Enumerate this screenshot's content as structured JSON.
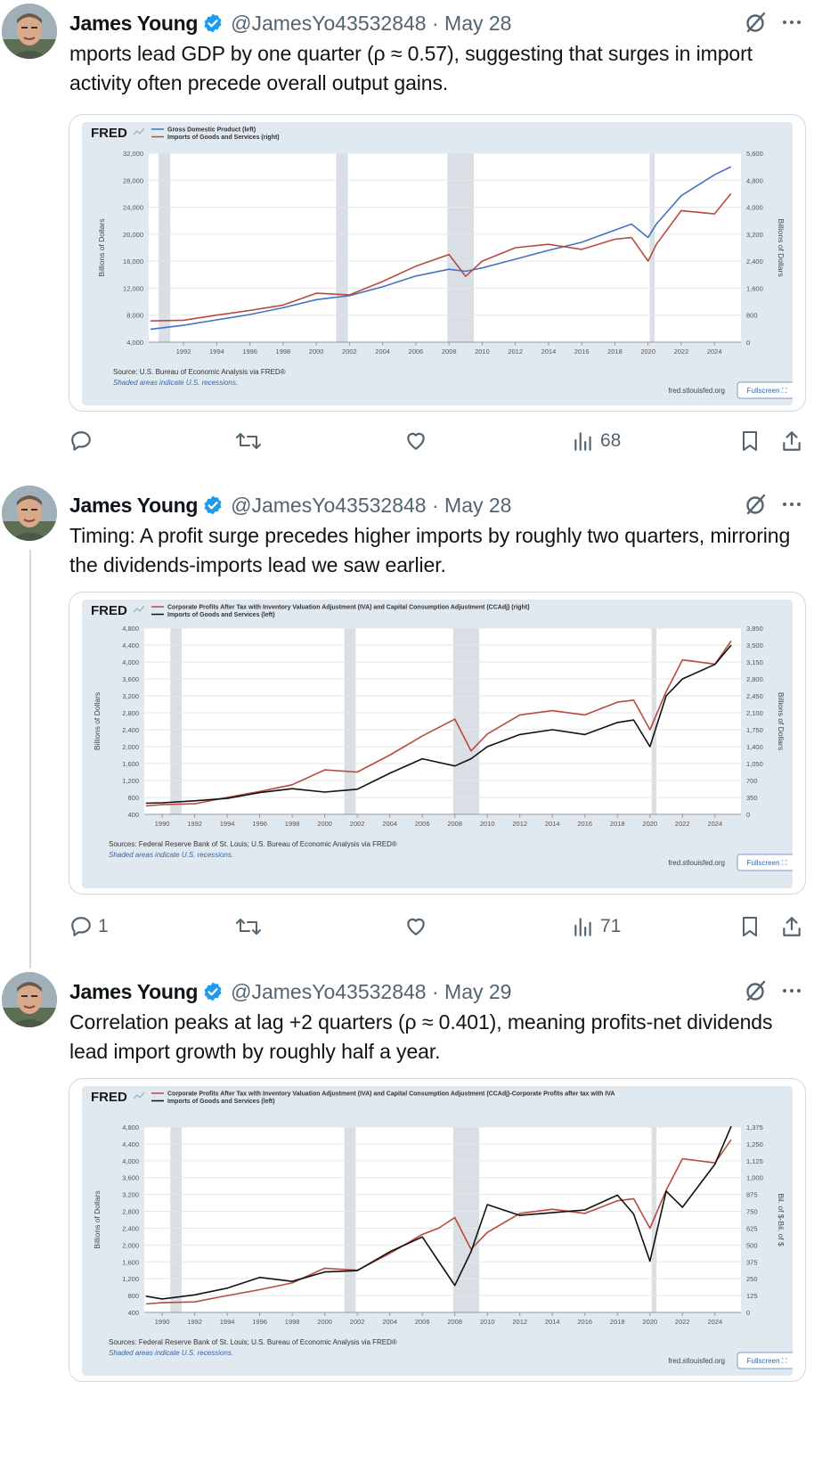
{
  "tweets": [
    {
      "author": {
        "name": "James Young",
        "handle": "@JamesYo43532848"
      },
      "date": "May 28",
      "text": "mports lead GDP by one quarter (ρ ≈ 0.57), suggesting that surges in import activity often precede overall output gains.",
      "chart": {
        "brand": "FRED",
        "legend": [
          "Gross Domestic Product (left)",
          "Imports of Goods and Services (right)"
        ],
        "left_axis_label": "Billions of Dollars",
        "right_axis_label": "Billions of Dollars",
        "left_ticks": [
          "32,000",
          "28,000",
          "24,000",
          "20,000",
          "16,000",
          "12,000",
          "8,000",
          "4,000"
        ],
        "right_ticks": [
          "5,600",
          "4,800",
          "4,000",
          "3,200",
          "2,400",
          "1,600",
          "800",
          "0"
        ],
        "x_ticks": [
          "1992",
          "1994",
          "1996",
          "1998",
          "2000",
          "2002",
          "2004",
          "2006",
          "2008",
          "2010",
          "2012",
          "2014",
          "2016",
          "2018",
          "2020",
          "2022",
          "2024"
        ],
        "source": "Source: U.S. Bureau of Economic Analysis via FRED®",
        "recession_note": "Shaded areas indicate U.S. recessions.",
        "site": "fred.stlouisfed.org",
        "fullscreen": "Fullscreen"
      },
      "stats": {
        "replies": "",
        "reposts": "",
        "likes": "",
        "views": "68"
      }
    },
    {
      "author": {
        "name": "James Young",
        "handle": "@JamesYo43532848"
      },
      "date": "May 28",
      "text": "Timing: A profit surge precedes higher imports by roughly two quarters, mirroring the dividends-imports lead we saw earlier.",
      "chart": {
        "brand": "FRED",
        "legend": [
          "Corporate Profits After Tax with Inventory Valuation Adjustment (IVA) and Capital Consumption Adjustment (CCAdj) (right)",
          "Imports of Goods and Services (left)"
        ],
        "left_axis_label": "Billions of Dollars",
        "right_axis_label": "Billions of Dollars",
        "left_ticks": [
          "4,800",
          "4,400",
          "4,000",
          "3,600",
          "3,200",
          "2,800",
          "2,400",
          "2,000",
          "1,600",
          "1,200",
          "800",
          "400"
        ],
        "right_ticks": [
          "3,850",
          "3,500",
          "3,150",
          "2,800",
          "2,450",
          "2,100",
          "1,750",
          "1,400",
          "1,050",
          "700",
          "350",
          "0"
        ],
        "x_ticks": [
          "1990",
          "1992",
          "1994",
          "1996",
          "1998",
          "2000",
          "2002",
          "2004",
          "2006",
          "2008",
          "2010",
          "2012",
          "2014",
          "2016",
          "2018",
          "2020",
          "2022",
          "2024"
        ],
        "source": "Sources: Federal Reserve Bank of St. Louis; U.S. Bureau of Economic Analysis via FRED®",
        "recession_note": "Shaded areas indicate U.S. recessions.",
        "site": "fred.stlouisfed.org",
        "fullscreen": "Fullscreen"
      },
      "stats": {
        "replies": "1",
        "reposts": "",
        "likes": "",
        "views": "71"
      }
    },
    {
      "author": {
        "name": "James Young",
        "handle": "@JamesYo43532848"
      },
      "date": "May 29",
      "text": "Correlation peaks at lag +2 quarters (ρ ≈ 0.401), meaning profits-net dividends lead import growth by roughly half a year.",
      "chart": {
        "brand": "FRED",
        "legend": [
          "Corporate Profits After Tax with Inventory Valuation Adjustment (IVA) and Capital Consumption Adjustment (CCAdj)-Corporate Profits after tax with IVA and CCAdj: Net Dividends (right)",
          "Imports of Goods and Services (left)"
        ],
        "left_axis_label": "Billions of Dollars",
        "right_axis_label": "Bil. of $-Bil. of $",
        "left_ticks": [
          "4,800",
          "4,400",
          "4,000",
          "3,600",
          "3,200",
          "2,800",
          "2,400",
          "2,000",
          "1,600",
          "1,200",
          "800",
          "400"
        ],
        "right_ticks": [
          "1,375",
          "1,250",
          "1,125",
          "1,000",
          "875",
          "750",
          "625",
          "500",
          "375",
          "250",
          "125",
          "0"
        ],
        "x_ticks": [
          "1990",
          "1992",
          "1994",
          "1996",
          "1998",
          "2000",
          "2002",
          "2004",
          "2006",
          "2008",
          "2010",
          "2012",
          "2014",
          "2016",
          "2018",
          "2020",
          "2022",
          "2024"
        ],
        "source": "Sources: Federal Reserve Bank of St. Louis; U.S. Bureau of Economic Analysis via FRED®",
        "recession_note": "Shaded areas indicate U.S. recessions.",
        "site": "fred.stlouisfed.org",
        "fullscreen": "Fullscreen"
      },
      "stats": {
        "replies": "",
        "reposts": "",
        "likes": "",
        "views": ""
      }
    }
  ],
  "chart_data": [
    {
      "type": "line",
      "x": [
        1990,
        1992,
        1994,
        1996,
        1998,
        2000,
        2002,
        2004,
        2006,
        2008,
        2009,
        2010,
        2012,
        2014,
        2016,
        2018,
        2019,
        2020,
        2020.5,
        2022,
        2024,
        2025
      ],
      "series": [
        {
          "name": "Gross Domestic Product (left)",
          "axis": "left",
          "color": "#4572c4",
          "values": [
            5900,
            6500,
            7300,
            8100,
            9100,
            10300,
            10900,
            12200,
            13800,
            14800,
            14500,
            15000,
            16300,
            17600,
            18800,
            20600,
            21500,
            19500,
            21500,
            25700,
            28800,
            30000
          ]
        },
        {
          "name": "Imports of Goods and Services (right)",
          "axis": "right",
          "color": "#b84a3f",
          "values": [
            630,
            650,
            800,
            940,
            1100,
            1450,
            1400,
            1800,
            2250,
            2600,
            1950,
            2400,
            2800,
            2900,
            2750,
            3050,
            3100,
            2400,
            2900,
            3900,
            3800,
            4400
          ]
        }
      ],
      "xlim": [
        1989.9,
        2025.6
      ],
      "left_ylim": [
        4000,
        32000
      ],
      "right_ylim": [
        0,
        5600
      ],
      "recessions": [
        [
          1990.5,
          1991.2
        ],
        [
          2001.2,
          2001.9
        ],
        [
          2007.9,
          2009.5
        ],
        [
          2020.1,
          2020.4
        ]
      ]
    },
    {
      "type": "line",
      "x": [
        1989,
        1990,
        1992,
        1994,
        1996,
        1998,
        2000,
        2002,
        2004,
        2006,
        2008,
        2009,
        2010,
        2012,
        2014,
        2016,
        2018,
        2019,
        2020,
        2021,
        2022,
        2024,
        2025
      ],
      "series": [
        {
          "name": "Imports of Goods and Services (left)",
          "axis": "left",
          "color": "#b84a3f",
          "values": [
            600,
            630,
            650,
            800,
            940,
            1100,
            1450,
            1400,
            1800,
            2250,
            2650,
            1900,
            2300,
            2750,
            2850,
            2750,
            3050,
            3100,
            2400,
            3300,
            4050,
            3950,
            4500
          ]
        },
        {
          "name": "Corporate Profits After Tax with Inventory Valuation Adjustment (IVA) and Capital Consumption Adjustment (CCAdj) (right)",
          "axis": "right",
          "color": "#111111",
          "values": [
            230,
            240,
            280,
            330,
            450,
            530,
            460,
            520,
            850,
            1150,
            1000,
            1150,
            1400,
            1650,
            1750,
            1650,
            1900,
            1950,
            1400,
            2450,
            2800,
            3100,
            3500
          ]
        }
      ],
      "xlim": [
        1988.9,
        2025.6
      ],
      "left_ylim": [
        400,
        4800
      ],
      "right_ylim": [
        0,
        3850
      ],
      "recessions": [
        [
          1990.5,
          1991.2
        ],
        [
          2001.2,
          2001.9
        ],
        [
          2007.9,
          2009.5
        ],
        [
          2020.1,
          2020.4
        ]
      ]
    },
    {
      "type": "line",
      "x": [
        1989,
        1990,
        1992,
        1994,
        1996,
        1998,
        2000,
        2002,
        2004,
        2006,
        2007,
        2008,
        2009,
        2010,
        2012,
        2014,
        2016,
        2018,
        2019,
        2020,
        2021,
        2022,
        2024,
        2025
      ],
      "series": [
        {
          "name": "Imports of Goods and Services (left)",
          "axis": "left",
          "color": "#b84a3f",
          "values": [
            600,
            630,
            650,
            800,
            940,
            1100,
            1450,
            1400,
            1800,
            2250,
            2400,
            2650,
            1900,
            2300,
            2750,
            2850,
            2750,
            3050,
            3100,
            2400,
            3300,
            4050,
            3950,
            4500
          ]
        },
        {
          "name": "Corporate Profits After Tax with Inventory Valuation Adjustment (IVA) and Capital Consumption Adjustment (CCAdj)-Corporate Profits after tax with IVA and CCAdj: Net Dividends (right)",
          "axis": "right",
          "color": "#111111",
          "values": [
            120,
            100,
            130,
            180,
            260,
            230,
            300,
            310,
            450,
            560,
            380,
            200,
            450,
            800,
            720,
            740,
            760,
            870,
            730,
            380,
            900,
            780,
            1100,
            1380
          ]
        }
      ],
      "xlim": [
        1988.9,
        2025.6
      ],
      "left_ylim": [
        400,
        4800
      ],
      "right_ylim": [
        0,
        1375
      ],
      "recessions": [
        [
          1990.5,
          1991.2
        ],
        [
          2001.2,
          2001.9
        ],
        [
          2007.9,
          2009.5
        ],
        [
          2020.1,
          2020.4
        ]
      ]
    }
  ]
}
